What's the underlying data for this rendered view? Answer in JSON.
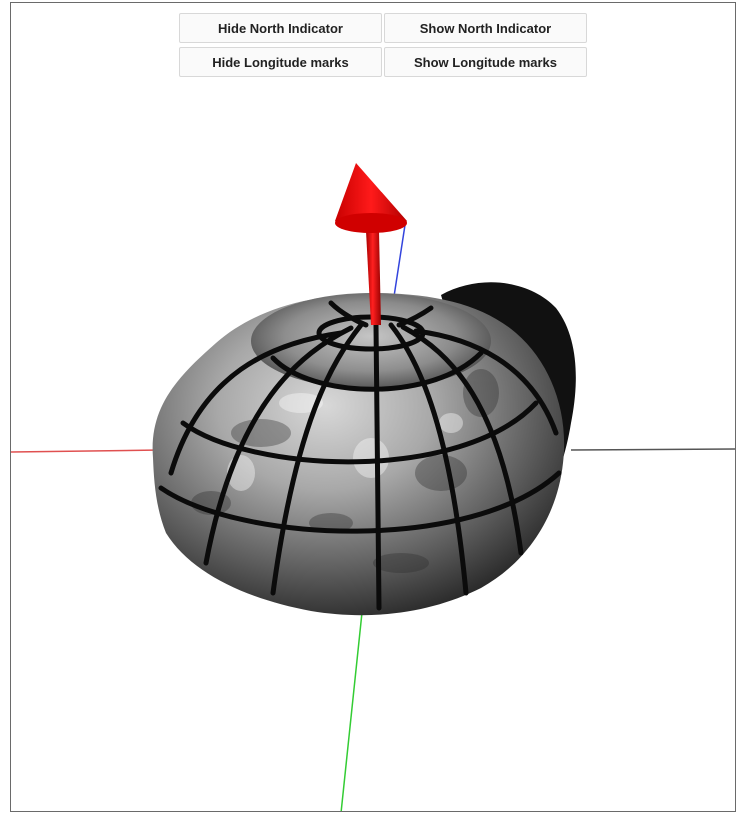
{
  "toolbar": {
    "hide_north_label": "Hide North Indicator",
    "show_north_label": "Show North Indicator",
    "hide_longitude_label": "Hide Longitude marks",
    "show_longitude_label": "Show Longitude marks"
  },
  "scene": {
    "north_indicator_color": "#ee0000",
    "axis_x_color": "#e05050",
    "axis_y_color": "#33cc33",
    "axis_z_color": "#3344dd",
    "axis_right_color": "#555555"
  }
}
